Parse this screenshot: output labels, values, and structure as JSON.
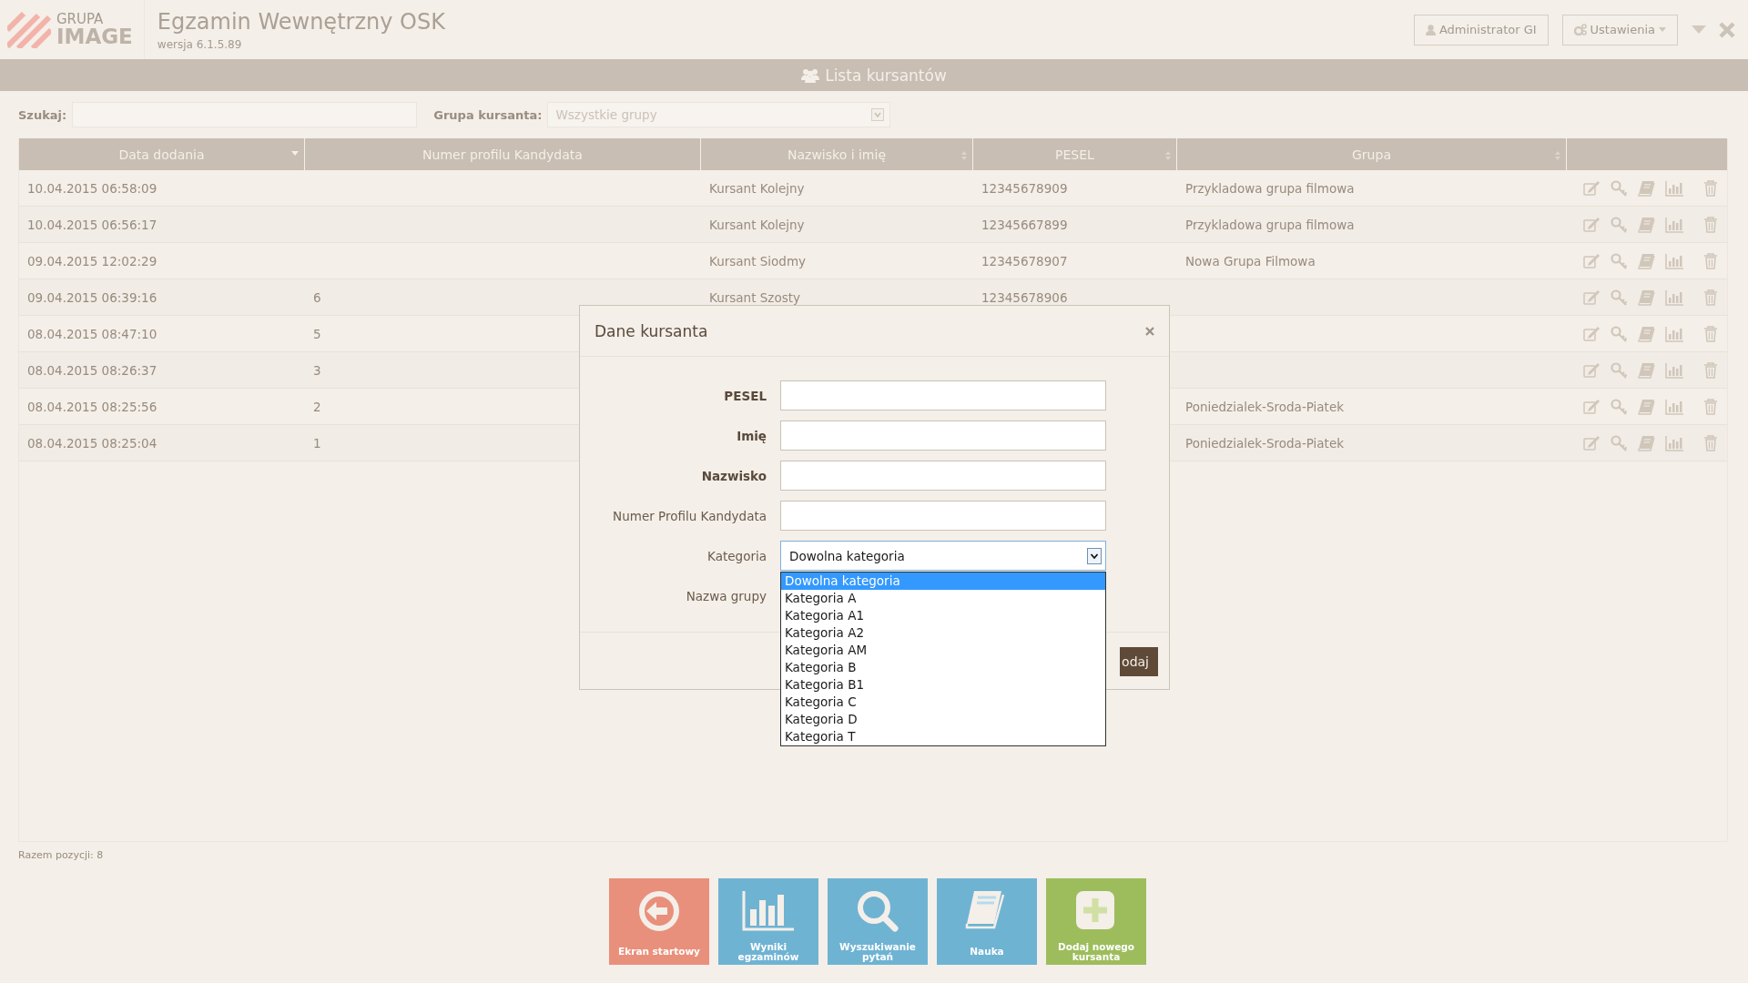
{
  "app": {
    "logo_top": "GRUPA",
    "logo_bottom": "IMAGE",
    "title": "Egzamin Wewnętrzny OSK",
    "version": "wersja 6.1.5.89"
  },
  "toolbar": {
    "user_button": "Administrator GI",
    "settings_button": "Ustawienia"
  },
  "list_bar": {
    "title": "Lista kursantów"
  },
  "filters": {
    "search_label": "Szukaj:",
    "group_label": "Grupa kursanta:",
    "group_value": "Wszystkie grupy"
  },
  "table": {
    "columns": [
      {
        "label": "Data dodania",
        "sorted": true
      },
      {
        "label": "Numer profilu Kandydata",
        "sorted": false
      },
      {
        "label": "Nazwisko i imię",
        "sorted": false
      },
      {
        "label": "PESEL",
        "sorted": false
      },
      {
        "label": "Grupa",
        "sorted": false
      }
    ],
    "rows": [
      {
        "date": "10.04.2015 06:58:09",
        "name": "Kursant Kolejny",
        "pesel": "12345678909",
        "group": "Przykladowa grupa filmowa"
      },
      {
        "date": "10.04.2015 06:56:17",
        "name": "Kursant Kolejny",
        "pesel": "12345667899",
        "group": "Przykladowa grupa filmowa"
      },
      {
        "date": "09.04.2015 12:02:29",
        "name": "Kursant Siodmy",
        "pesel": "12345678907",
        "group": "Nowa Grupa Filmowa"
      },
      {
        "date": "09.04.2015 06:39:16",
        "profile_number": "6",
        "name": "Kursant Szosty",
        "pesel": "12345678906"
      },
      {
        "date": "08.04.2015 08:47:10",
        "profile_number": "5"
      },
      {
        "date": "08.04.2015 08:26:37",
        "profile_number": "3"
      },
      {
        "date": "08.04.2015 08:25:56",
        "profile_number": "2",
        "group": "Poniedzialek-Sroda-Piatek"
      },
      {
        "date": "08.04.2015 08:25:04",
        "profile_number": "1",
        "group": "Poniedzialek-Sroda-Piatek"
      }
    ]
  },
  "status": "Razem pozycji: 8",
  "modal": {
    "title": "Dane kursanta",
    "fields": [
      {
        "label": "PESEL",
        "kind": "text",
        "required": true
      },
      {
        "label": "Imię",
        "kind": "text",
        "required": true
      },
      {
        "label": "Nazwisko",
        "kind": "text",
        "required": true
      },
      {
        "label": "Numer Profilu Kandydata",
        "kind": "text",
        "required": false
      },
      {
        "label": "Kategoria",
        "kind": "select",
        "required": false,
        "value": "Dowolna kategoria",
        "expanded": true,
        "options": [
          {
            "label": "Dowolna kategoria",
            "selected": true
          },
          {
            "label": "Kategoria A",
            "selected": false
          },
          {
            "label": "Kategoria A1",
            "selected": false
          },
          {
            "label": "Kategoria A2",
            "selected": false
          },
          {
            "label": "Kategoria AM",
            "selected": false
          },
          {
            "label": "Kategoria B",
            "selected": false
          },
          {
            "label": "Kategoria B1",
            "selected": false
          },
          {
            "label": "Kategoria C",
            "selected": false
          },
          {
            "label": "Kategoria D",
            "selected": false
          },
          {
            "label": "Kategoria T",
            "selected": false
          }
        ]
      },
      {
        "label": "Nazwa grupy",
        "kind": "label",
        "required": false
      }
    ],
    "submit": "odaj"
  },
  "tiles": [
    {
      "label": "Ekran startowy",
      "color": "#e8907c"
    },
    {
      "label": "Wyniki egzaminów",
      "color": "#6fb3d3"
    },
    {
      "label": "Wyszukiwanie pytań",
      "color": "#6fb3d3"
    },
    {
      "label": "Nauka",
      "color": "#6fb3d3"
    },
    {
      "label": "Dodaj nowego kursanta",
      "color": "#9dbd5c"
    }
  ]
}
